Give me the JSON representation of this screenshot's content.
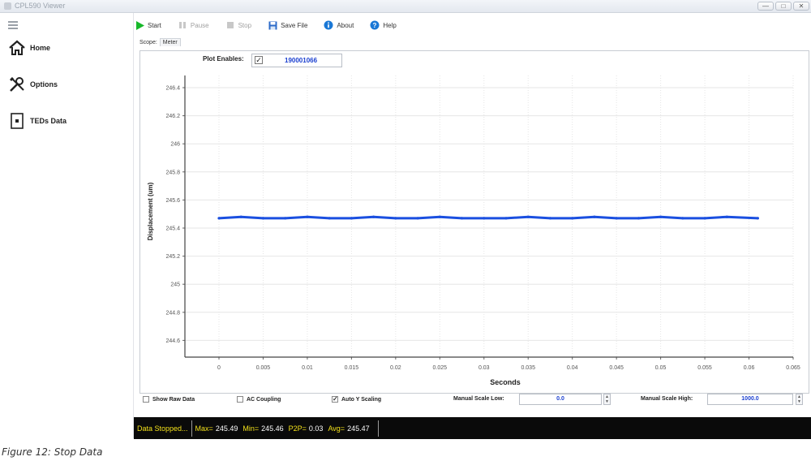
{
  "window": {
    "title": "CPL590 Viewer",
    "controls": [
      "—",
      "□",
      "✕"
    ]
  },
  "sidebar": {
    "items": [
      {
        "label": "Home",
        "icon": "home-icon"
      },
      {
        "label": "Options",
        "icon": "tools-icon"
      },
      {
        "label": "TEDs Data",
        "icon": "chip-icon"
      }
    ]
  },
  "toolbar": {
    "start": "Start",
    "pause": "Pause",
    "stop": "Stop",
    "save_file": "Save File",
    "about": "About",
    "help": "Help"
  },
  "scope": {
    "label": "Scope:",
    "tab": "Meter"
  },
  "plot_enables": {
    "label": "Plot Enables:",
    "checked": "✓",
    "channel": "190001066"
  },
  "chart_data": {
    "type": "line",
    "xlabel": "Seconds",
    "ylabel": "Displacement (um)",
    "xlim": [
      0,
      0.065
    ],
    "ylim": [
      244.5,
      246.5
    ],
    "x_ticks": [
      "0",
      "0.005",
      "0.01",
      "0.015",
      "0.02",
      "0.025",
      "0.03",
      "0.035",
      "0.04",
      "0.045",
      "0.05",
      "0.055",
      "0.06",
      "0.065"
    ],
    "y_ticks": [
      "246.4",
      "246.2",
      "246",
      "245.8",
      "245.6",
      "245.4",
      "245.2",
      "245",
      "244.8",
      "244.6"
    ],
    "grid": true,
    "series_color": "#1a4fe0",
    "series": [
      {
        "x": [
          0,
          0.0025,
          0.005,
          0.0075,
          0.01,
          0.0125,
          0.015,
          0.0175,
          0.02,
          0.0225,
          0.025,
          0.0275,
          0.03,
          0.0325,
          0.035,
          0.0375,
          0.04,
          0.0425,
          0.045,
          0.0475,
          0.05,
          0.0525,
          0.055,
          0.0575,
          0.061
        ],
        "y": [
          245.47,
          245.48,
          245.47,
          245.47,
          245.48,
          245.47,
          245.47,
          245.48,
          245.47,
          245.47,
          245.48,
          245.47,
          245.47,
          245.47,
          245.48,
          245.47,
          245.47,
          245.48,
          245.47,
          245.47,
          245.48,
          245.47,
          245.47,
          245.48,
          245.47
        ]
      }
    ]
  },
  "controls": {
    "show_raw_data": "Show Raw Data",
    "ac_coupling": "AC Coupling",
    "auto_y_scaling": "Auto Y Scaling",
    "auto_check": "✓",
    "manual_low_label": "Manual Scale Low:",
    "manual_low_value": "0.0",
    "manual_high_label": "Manual Scale High:",
    "manual_high_value": "1000.0",
    "spin_up": "▲",
    "spin_down": "▼"
  },
  "status": {
    "state": "Data Stopped...",
    "max_label": "Max=",
    "max": "245.49",
    "min_label": "Min=",
    "min": "245.46",
    "p2p_label": "P2P=",
    "p2p": "0.03",
    "avg_label": "Avg=",
    "avg": "245.47"
  },
  "caption": "Figure 12: Stop Data"
}
